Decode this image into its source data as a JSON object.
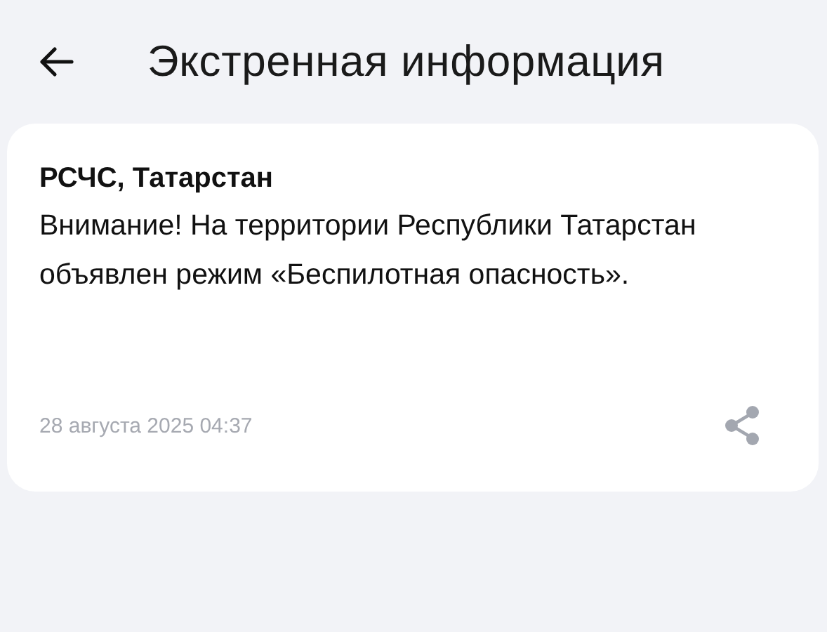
{
  "header": {
    "title": "Экстренная информация"
  },
  "alerts": [
    {
      "source": "РСЧС, Татарстан",
      "message": "Внимание! На территории Республики Татарстан объявлен режим «Беспилотная опасность».",
      "date": "28 августа 2025 04:37"
    }
  ]
}
